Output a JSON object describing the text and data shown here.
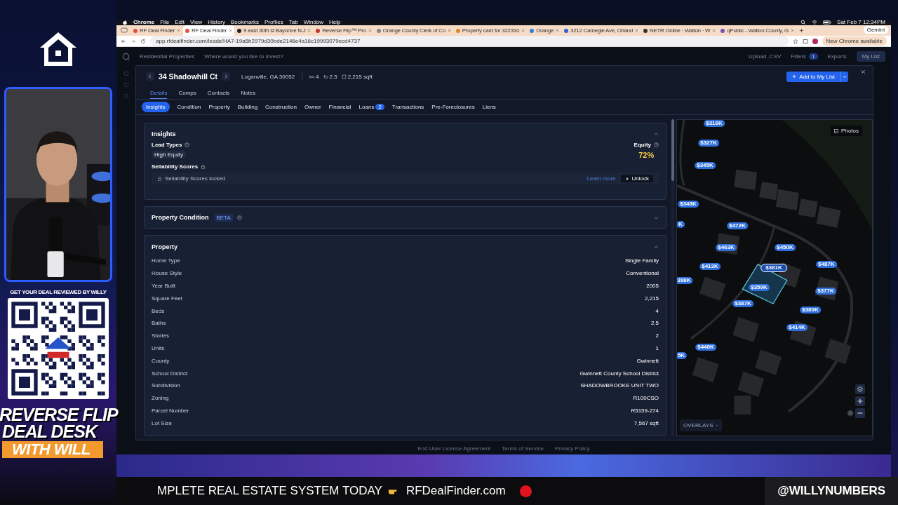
{
  "overlay": {
    "qr_caption": "GET YOUR DEAL REVIEWED BY WILLY",
    "show_title": [
      "REVERSE FLIP",
      "DEAL DESK"
    ],
    "show_subtitle": "WITH WILL",
    "ticker": "MPLETE REAL ESTATE SYSTEM TODAY",
    "ticker_link": "RFDealFinder.com",
    "handle": "@WILLYNUMBERS"
  },
  "menu_bar": {
    "app": "Chrome",
    "items": [
      "File",
      "Edit",
      "View",
      "History",
      "Bookmarks",
      "Profiles",
      "Tab",
      "Window",
      "Help"
    ],
    "clock": "Sat Feb 7  12:34PM"
  },
  "browser_tabs": [
    {
      "title": "RF Deal Finder",
      "selected": false
    },
    {
      "title": "RF Deal Finder",
      "selected": true
    },
    {
      "title": "9 east 30th st Bayonne N.J",
      "selected": false
    },
    {
      "title": "Reverse Flip™ Pro",
      "selected": false
    },
    {
      "title": "Orange County Clerk of Co",
      "selected": false
    },
    {
      "title": "Property card for 322310",
      "selected": false
    },
    {
      "title": "Orange",
      "selected": false
    },
    {
      "title": "3212 Carnegie Ave, Orland",
      "selected": false
    },
    {
      "title": "NETR Online · Walton · W",
      "selected": false
    },
    {
      "title": "qPublic - Walton County, G",
      "selected": false
    }
  ],
  "gemini": "Gemini",
  "address_bar": {
    "url": "app.rfdealfinder.com/leads/HA7-19a5b2979d30bde2146e4a16c19993079ecd4737",
    "update": "New Chrome available"
  },
  "app_nav": {
    "scope": "Residential Properties",
    "search_placeholder": "Where would you like to invest?",
    "upload": "Upload .CSV",
    "filters": "Filters",
    "filters_count": "1",
    "exports": "Exports",
    "my_list": "My List"
  },
  "property": {
    "address": "34 Shadowhill Ct",
    "city": "Loganville, GA 30052",
    "beds": "4",
    "baths": "2.5",
    "sqft": "2,215 sqft",
    "add_button": "Add to My List"
  },
  "view_tabs": [
    {
      "label": "Details",
      "selected": true
    },
    {
      "label": "Comps",
      "selected": false
    },
    {
      "label": "Contacts",
      "selected": false
    },
    {
      "label": "Notes",
      "selected": false
    }
  ],
  "section_tabs": [
    {
      "label": "Insights",
      "selected": true
    },
    {
      "label": "Condition",
      "selected": false
    },
    {
      "label": "Property",
      "selected": false
    },
    {
      "label": "Building",
      "selected": false
    },
    {
      "label": "Construction",
      "selected": false
    },
    {
      "label": "Owner",
      "selected": false
    },
    {
      "label": "Financial",
      "selected": false
    },
    {
      "label": "Loans",
      "badge": "2",
      "selected": false
    },
    {
      "label": "Transactions",
      "selected": false
    },
    {
      "label": "Pre-Foreclosures",
      "selected": false
    },
    {
      "label": "Liens",
      "selected": false
    }
  ],
  "insights": {
    "title": "Insights",
    "expanded": true,
    "lead_types_label": "Lead Types",
    "lead_tag": "High Equity",
    "equity_label": "Equity",
    "equity": "72%",
    "sellability_label": "Sellability Scores",
    "locked_text": "Sellability Scores locked",
    "learn_more": "Learn more",
    "unlock": "Unlock"
  },
  "condition": {
    "title": "Property Condition",
    "badge": "BETA",
    "expanded": false
  },
  "property_section": {
    "title": "Property",
    "expanded": true,
    "rows": [
      {
        "label": "Home Type",
        "value": "Single Family"
      },
      {
        "label": "House Style",
        "value": "Conventional"
      },
      {
        "label": "Year Built",
        "value": "2005"
      },
      {
        "label": "Square Feet",
        "value": "2,215"
      },
      {
        "label": "Beds",
        "value": "4"
      },
      {
        "label": "Baths",
        "value": "2.5"
      },
      {
        "label": "Stories",
        "value": "2"
      },
      {
        "label": "Units",
        "value": "1"
      },
      {
        "label": "County",
        "value": "Gwinnett"
      },
      {
        "label": "School District",
        "value": "Gwinnett County School District"
      },
      {
        "label": "Subdivision",
        "value": "SHADOWBROOKE UNIT TWO"
      },
      {
        "label": "Zoning",
        "value": "R100CSO"
      },
      {
        "label": "Parcel Number",
        "value": "R5159-274"
      },
      {
        "label": "Lot Size",
        "value": "7,567 sqft"
      }
    ]
  },
  "map": {
    "photos": "Photos",
    "overlays": "OVERLAYS",
    "pins": [
      {
        "price": "$316K",
        "selected": false
      },
      {
        "price": "$327K",
        "selected": false
      },
      {
        "price": "$345K",
        "selected": false
      },
      {
        "price": "$348K",
        "selected": false
      },
      {
        "price": "K",
        "selected": false
      },
      {
        "price": "$472K",
        "selected": false
      },
      {
        "price": "$463K",
        "selected": false
      },
      {
        "price": "$450K",
        "selected": false
      },
      {
        "price": "$413K",
        "selected": false
      },
      {
        "price": "$381K",
        "selected": true
      },
      {
        "price": "$487K",
        "selected": false
      },
      {
        "price": "398K",
        "selected": false
      },
      {
        "price": "$359K",
        "selected": false
      },
      {
        "price": "$377K",
        "selected": false
      },
      {
        "price": "$387K",
        "selected": false
      },
      {
        "price": "$380K",
        "selected": false
      },
      {
        "price": "$414K",
        "selected": false
      },
      {
        "price": "$448K",
        "selected": false
      },
      {
        "price": "5K",
        "selected": false
      }
    ]
  },
  "footer_links": [
    "End User License Agreement",
    "Terms of Service",
    "Privacy Policy"
  ]
}
